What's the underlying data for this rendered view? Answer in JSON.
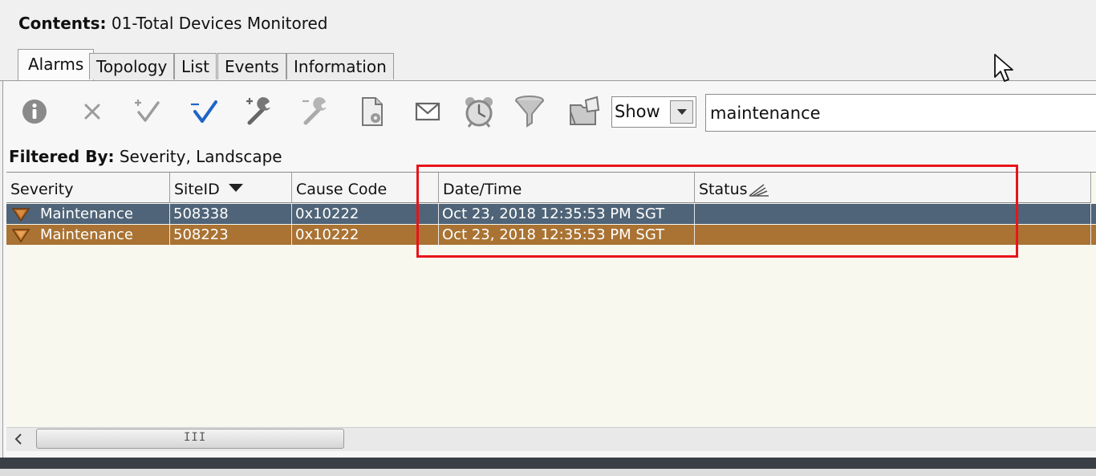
{
  "contents": {
    "label": "Contents:",
    "value": "01-Total Devices Monitored"
  },
  "tabs": [
    {
      "label": "Alarms",
      "active": true
    },
    {
      "label": "Topology"
    },
    {
      "label": "List"
    },
    {
      "label": "Events"
    },
    {
      "label": "Information"
    }
  ],
  "toolbar": {
    "icons": [
      "info-icon",
      "clear-alarm-icon",
      "acknowledge-add-icon",
      "acknowledge-icon",
      "set-maintenance-icon",
      "clear-maintenance-icon",
      "report-icon",
      "email-icon",
      "alarm-clock-icon",
      "filter-funnel-icon",
      "export-folder-icon"
    ],
    "show_select": "Show",
    "search_value": "maintenance"
  },
  "filter": {
    "label": "Filtered By:",
    "value": "Severity, Landscape"
  },
  "table": {
    "columns": [
      "Severity",
      "SiteID",
      "Cause Code",
      "Date/Time",
      "Status"
    ],
    "rows": [
      {
        "severity": "Maintenance",
        "site_id": "508338",
        "cause_code": "0x10222",
        "date_time": "Oct 23, 2018 12:35:53 PM SGT",
        "status": ""
      },
      {
        "severity": "Maintenance",
        "site_id": "508223",
        "cause_code": "0x10222",
        "date_time": "Oct 23, 2018 12:35:53 PM SGT",
        "status": ""
      }
    ]
  },
  "scrollbar": {
    "grip": "III"
  },
  "colors": {
    "row_selected": "#4f6478",
    "row_maintenance": "#aa7333",
    "highlight": "#e8141a",
    "acknowledge_blue": "#1f64c8"
  }
}
